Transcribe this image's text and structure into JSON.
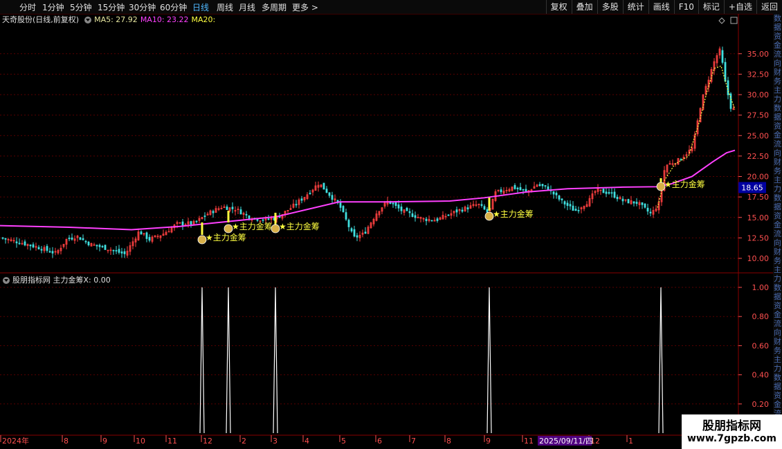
{
  "toolbar": {
    "timeframes": [
      "分时",
      "1分钟",
      "5分钟",
      "15分钟",
      "30分钟",
      "60分钟",
      "日线",
      "周线",
      "月线",
      "多周期",
      "更多 >"
    ],
    "active_index": 6,
    "right_buttons": [
      "复权",
      "叠加",
      "多股",
      "统计",
      "画线",
      "F10",
      "标记",
      "+自选",
      "返回"
    ]
  },
  "price_info": {
    "stock": "天奇股份(日线,前复权)",
    "ma5": "MA5: 27.92",
    "ma10": "MA10: 23.22",
    "ma20": "MA20:"
  },
  "indicator_info": {
    "text": "股朋指标网  主力金筹X: 0.00"
  },
  "price_axis": {
    "ticks": [
      "35.00",
      "32.50",
      "30.00",
      "27.50",
      "25.00",
      "22.50",
      "20.00",
      "17.50",
      "15.00",
      "12.50",
      "10.00"
    ],
    "current_price": "18.65"
  },
  "indicator_axis": {
    "ticks": [
      "1.00",
      "0.80",
      "0.60",
      "0.40",
      "0.20"
    ]
  },
  "time_axis": {
    "labels": [
      "2024年",
      "8",
      "9",
      "10",
      "11",
      "12",
      "2",
      "3",
      "4",
      "5",
      "6",
      "7",
      "8",
      "9",
      "11",
      "12",
      "1"
    ],
    "cursor_label": "2025/09/11/四"
  },
  "signals": [
    {
      "label": "★主力金筹",
      "value": 1
    },
    {
      "label": "★主力金筹",
      "value": 1
    },
    {
      "label": "★主力金筹",
      "value": 1
    },
    {
      "label": "★主力金筹",
      "value": 1
    },
    {
      "label": "★主力金筹",
      "value": 1
    }
  ],
  "sidebar_text": "数据资金流向财务主力",
  "watermark": {
    "line1": "股朋指标网",
    "line2": "www.7gpzb.com"
  },
  "colors": {
    "up": "#ff4040",
    "down": "#40e0e0",
    "ma": "#ff40ff",
    "signal": "#ffff40",
    "grid": "#5a0000",
    "axis_text": "#ff5050"
  }
}
